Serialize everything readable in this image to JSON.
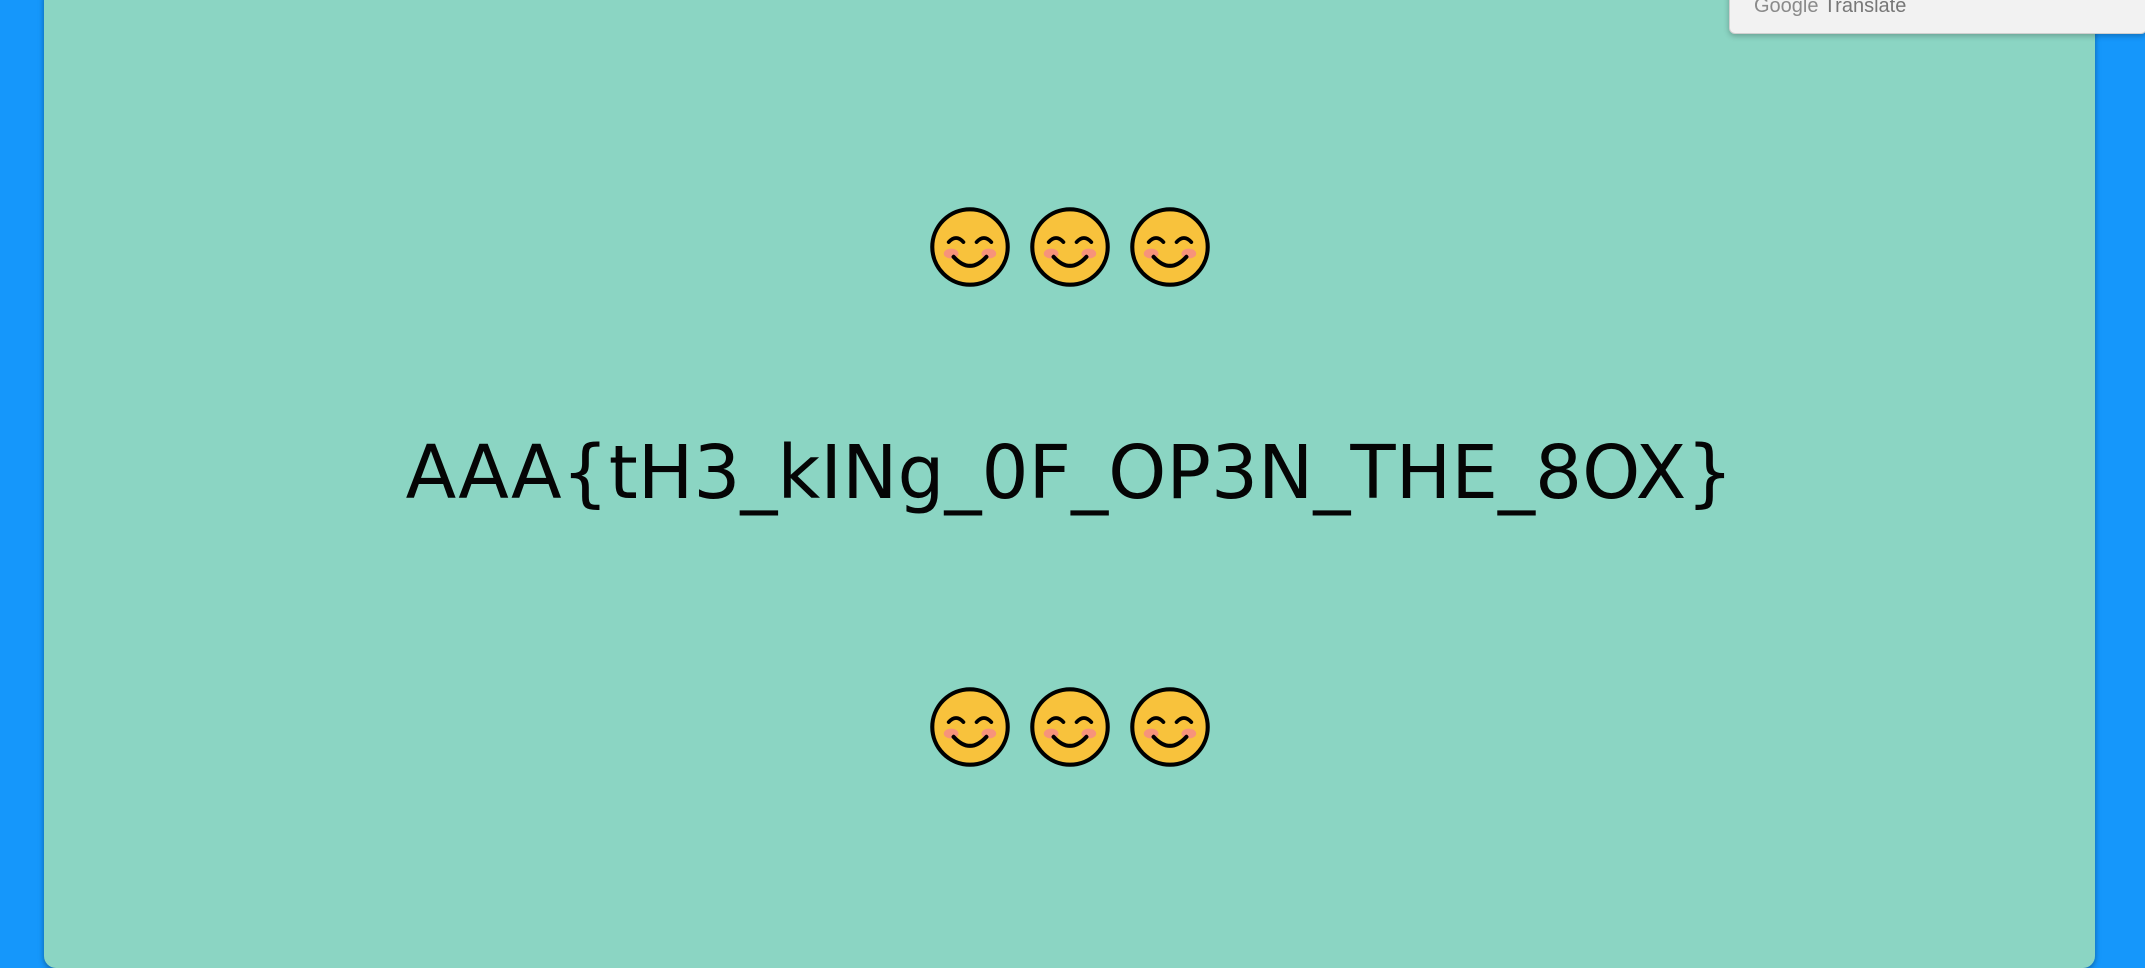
{
  "flag_text": "AAA{tH3_kINg_0F_OP3N_THE_8OX}",
  "emoji_rows": {
    "top": [
      "smiling-face-icon",
      "smiling-face-icon",
      "smiling-face-icon"
    ],
    "bottom": [
      "smiling-face-icon",
      "smiling-face-icon",
      "smiling-face-icon"
    ]
  },
  "translate_popup": {
    "brand": "Google",
    "product": "Translate"
  },
  "colors": {
    "page_background": "#1597fb",
    "card_background": "#8bd5c3",
    "emoji_face": "#f8c23c",
    "emoji_blush": "#f7937b"
  }
}
